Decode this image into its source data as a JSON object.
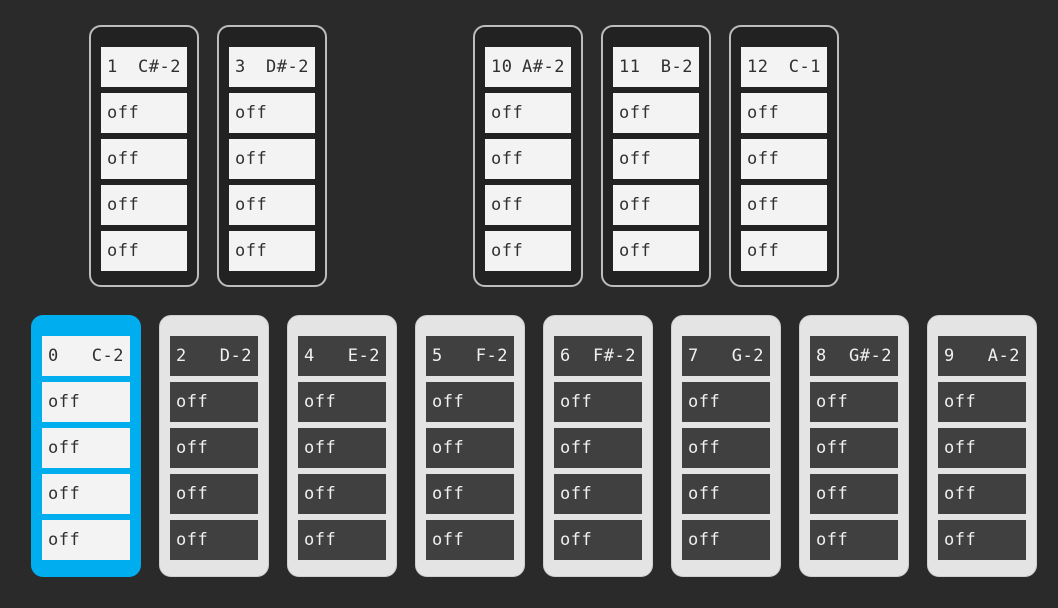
{
  "keys": [
    {
      "index": "1",
      "note": "C#-2",
      "slots": [
        "off",
        "off",
        "off",
        "off"
      ]
    },
    {
      "index": "3",
      "note": "D#-2",
      "slots": [
        "off",
        "off",
        "off",
        "off"
      ]
    },
    {
      "index": "10",
      "note": "A#-2",
      "slots": [
        "off",
        "off",
        "off",
        "off"
      ]
    },
    {
      "index": "11",
      "note": "B-2",
      "slots": [
        "off",
        "off",
        "off",
        "off"
      ]
    },
    {
      "index": "12",
      "note": "C-1",
      "slots": [
        "off",
        "off",
        "off",
        "off"
      ]
    },
    {
      "index": "0",
      "note": "C-2",
      "slots": [
        "off",
        "off",
        "off",
        "off"
      ]
    },
    {
      "index": "2",
      "note": "D-2",
      "slots": [
        "off",
        "off",
        "off",
        "off"
      ]
    },
    {
      "index": "4",
      "note": "E-2",
      "slots": [
        "off",
        "off",
        "off",
        "off"
      ]
    },
    {
      "index": "5",
      "note": "F-2",
      "slots": [
        "off",
        "off",
        "off",
        "off"
      ]
    },
    {
      "index": "6",
      "note": "F#-2",
      "slots": [
        "off",
        "off",
        "off",
        "off"
      ]
    },
    {
      "index": "7",
      "note": "G-2",
      "slots": [
        "off",
        "off",
        "off",
        "off"
      ]
    },
    {
      "index": "8",
      "note": "G#-2",
      "slots": [
        "off",
        "off",
        "off",
        "off"
      ]
    },
    {
      "index": "9",
      "note": "A-2",
      "slots": [
        "off",
        "off",
        "off",
        "off"
      ]
    }
  ],
  "colors": {
    "background": "#2a2a2a",
    "selected_accent": "#00aeef",
    "black_key_body": "#222222",
    "white_key_body": "#e4e4e4"
  }
}
